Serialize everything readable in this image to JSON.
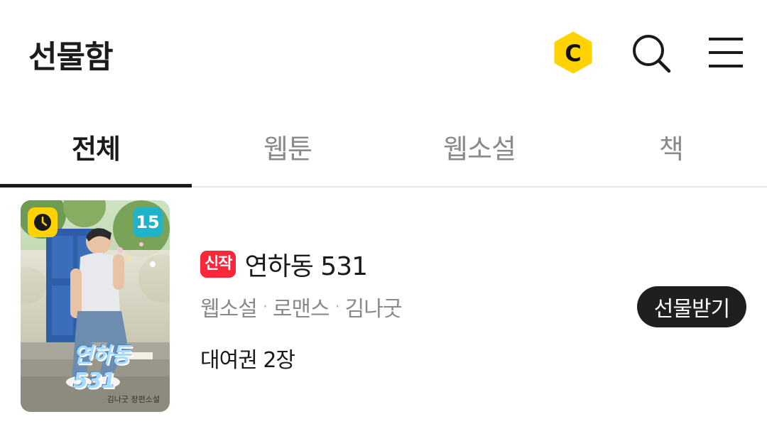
{
  "header": {
    "title": "선물함",
    "coin_letter": "C",
    "coin_color": "#ffd200"
  },
  "tabs": [
    {
      "label": "전체",
      "active": true
    },
    {
      "label": "웹툰",
      "active": false
    },
    {
      "label": "웹소설",
      "active": false
    },
    {
      "label": "책",
      "active": false
    }
  ],
  "items": [
    {
      "thumbnail": {
        "age_rating": "15",
        "cover_title": "연하동 531",
        "cover_subtitle": "김나굿 장편소설",
        "wait_free_icon": "clock-icon"
      },
      "badge": "신작",
      "title": "연하동 531",
      "meta": [
        "웹소설",
        "로맨스",
        "김나굿"
      ],
      "rental": "대여권 2장",
      "action_label": "선물받기"
    }
  ],
  "colors": {
    "new_badge": "#f8283a",
    "age_badge": "#1fb3c9",
    "button_bg": "#1f1f1f"
  }
}
